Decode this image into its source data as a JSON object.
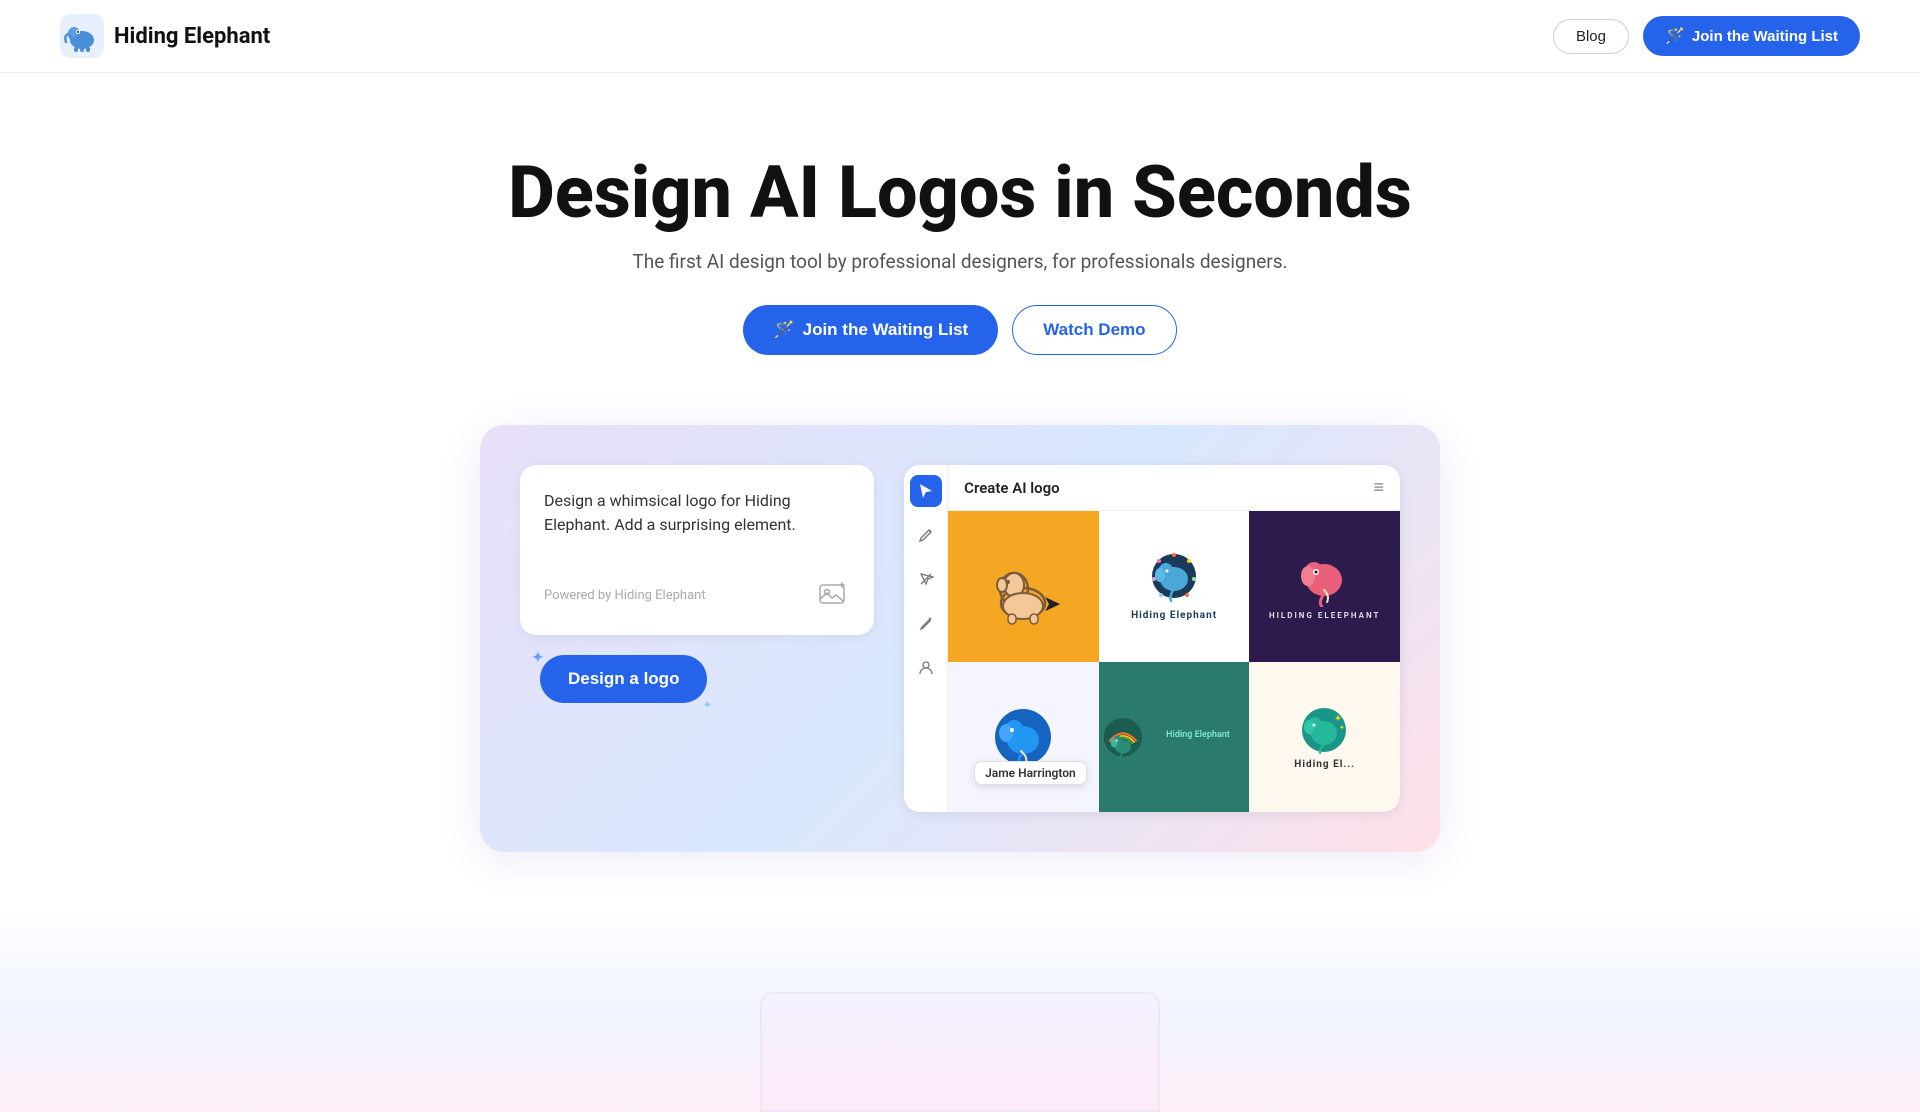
{
  "nav": {
    "logo_text": "Hiding Elephant",
    "blog_label": "Blog",
    "waiting_list_label": "Join the Waiting List",
    "wand_icon": "🪄"
  },
  "hero": {
    "title": "Design AI Logos in Seconds",
    "subtitle": "The first AI design tool by professional designers, for professionals designers.",
    "btn_waiting": "Join the Waiting List",
    "btn_demo": "Watch Demo",
    "wand_icon": "🪄"
  },
  "demo": {
    "prompt_text": "Design a whimsical logo for Hiding Elephant. Add a surprising element.",
    "powered_by": "Powered by Hiding Elephant",
    "design_btn": "Design a logo",
    "canvas_title": "Create AI logo",
    "tooltip_name": "Jame Harrington",
    "toolbar_icons": [
      "cursor",
      "pen",
      "vector",
      "pencil",
      "user"
    ],
    "menu_icon": "≡"
  }
}
